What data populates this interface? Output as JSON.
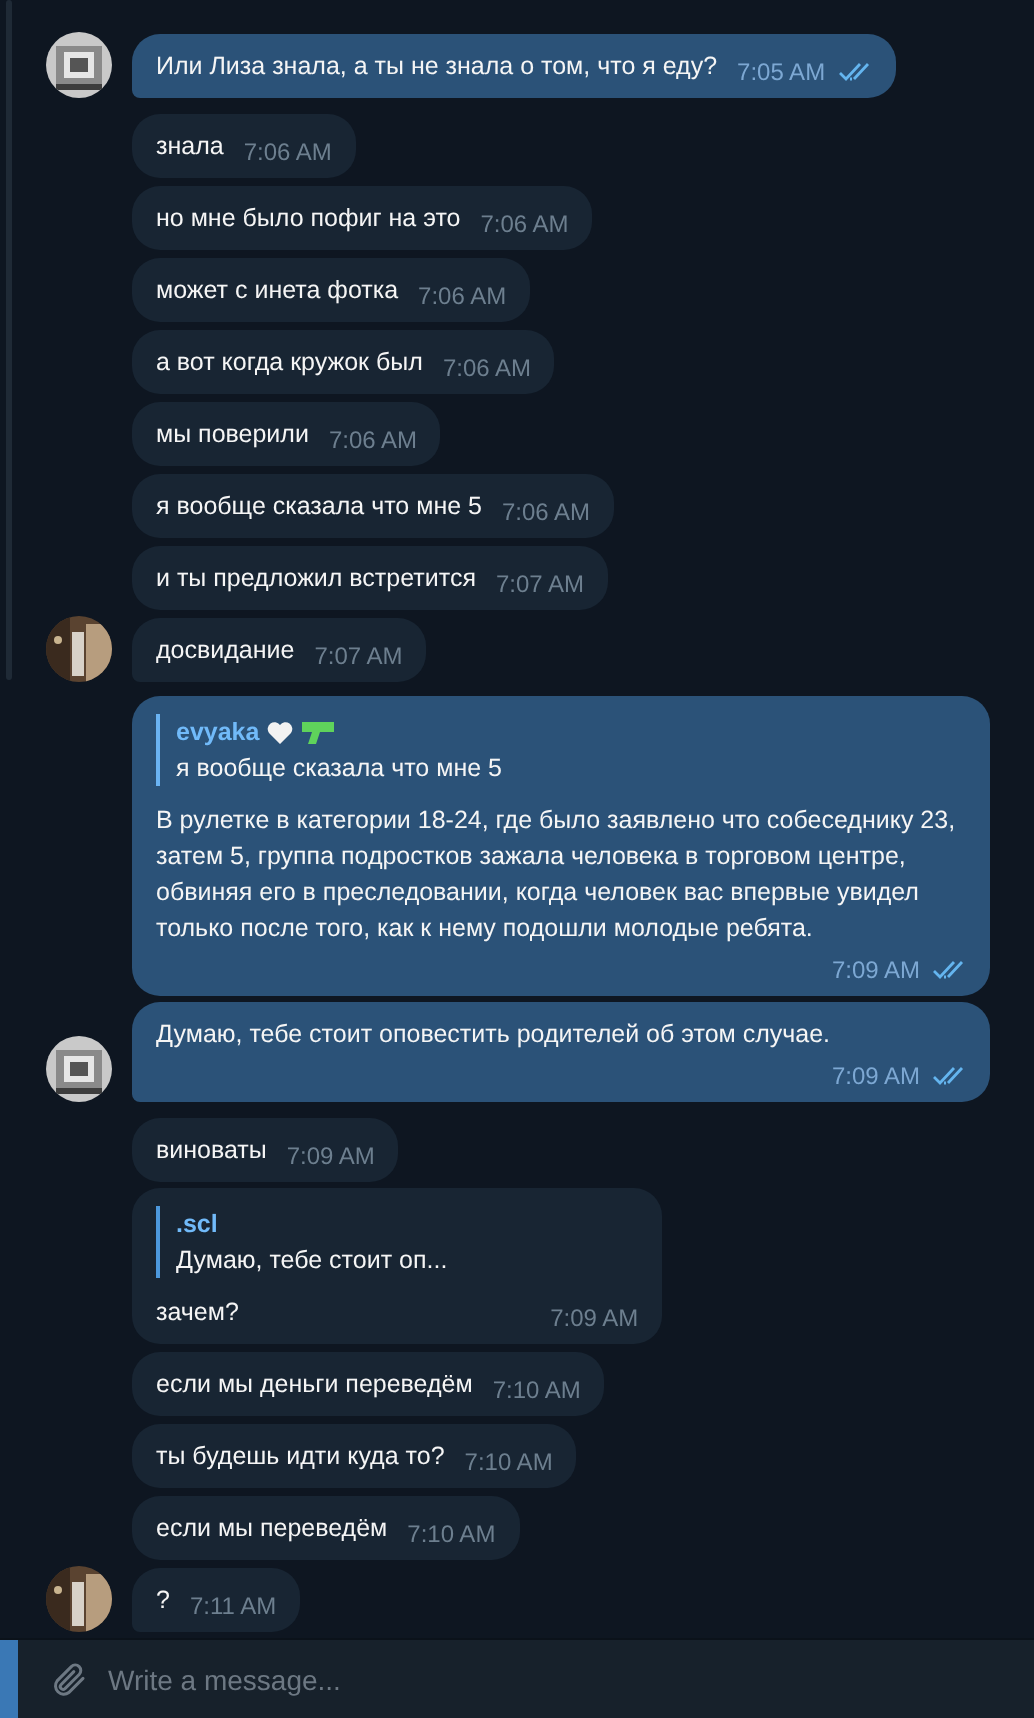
{
  "messages": [
    {
      "kind": "outgoing",
      "text": "Или Лиза знала, а ты не знала о том, что я еду?",
      "time": "7:05 AM",
      "read": true,
      "avatar": true
    },
    {
      "kind": "incoming",
      "text": "знала",
      "time": "7:06 AM",
      "avatar": false
    },
    {
      "kind": "incoming",
      "text": "но мне было пофиг на это",
      "time": "7:06 AM",
      "avatar": false
    },
    {
      "kind": "incoming",
      "text": "может с инета фотка",
      "time": "7:06 AM",
      "avatar": false
    },
    {
      "kind": "incoming",
      "text": "а вот когда кружок был",
      "time": "7:06 AM",
      "avatar": false
    },
    {
      "kind": "incoming",
      "text": "мы поверили",
      "time": "7:06 AM",
      "avatar": false
    },
    {
      "kind": "incoming",
      "text": "я вообще сказала что мне 5",
      "time": "7:06 AM",
      "avatar": false
    },
    {
      "kind": "incoming",
      "text": "и ты предложил встретится",
      "time": "7:07 AM",
      "avatar": false
    },
    {
      "kind": "incoming",
      "text": "досвидание",
      "time": "7:07 AM",
      "avatar": true
    },
    {
      "kind": "outgoing",
      "reply": {
        "name": "evyaka",
        "text": "я вообще сказала что мне 5"
      },
      "text": "В рулетке в категории 18-24, где было заявлено что собеседнику 23, затем 5, группа подростков зажала человека в торговом центре, обвиняя его в преследовании, когда человек вас впервые увидел только после того, как к нему подошли молодые ребята.",
      "time": "7:09 AM",
      "read": true,
      "avatar": false
    },
    {
      "kind": "outgoing",
      "text": "Думаю, тебе стоит оповестить родителей об этом случае.",
      "time": "7:09 AM",
      "read": true,
      "avatar": true
    },
    {
      "kind": "incoming",
      "text": "виноваты",
      "time": "7:09 AM",
      "avatar": false
    },
    {
      "kind": "incoming",
      "reply": {
        "name": ".scl",
        "text": "Думаю, тебе стоит оп..."
      },
      "text": "зачем?",
      "time": "7:09 AM",
      "avatar": false
    },
    {
      "kind": "incoming",
      "text": "если мы деньги переведём",
      "time": "7:10 AM",
      "avatar": false
    },
    {
      "kind": "incoming",
      "text": "ты будешь идти куда то?",
      "time": "7:10 AM",
      "avatar": false
    },
    {
      "kind": "incoming",
      "text": "если мы переведём",
      "time": "7:10 AM",
      "avatar": false
    },
    {
      "kind": "incoming",
      "text": "?",
      "time": "7:11 AM",
      "avatar": true
    }
  ],
  "composer": {
    "placeholder": "Write a message..."
  }
}
